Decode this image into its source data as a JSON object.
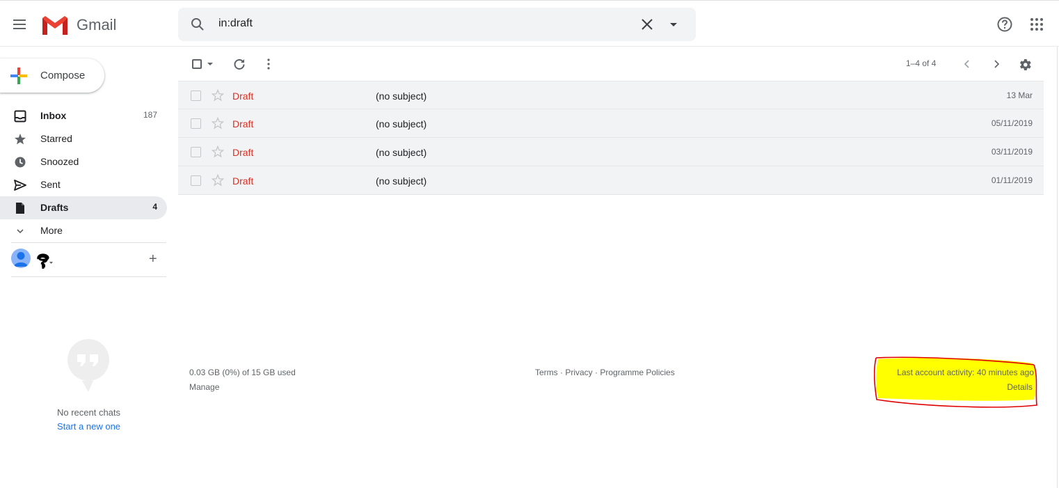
{
  "app": {
    "name": "Gmail"
  },
  "search": {
    "value": "in:draft"
  },
  "compose": {
    "label": "Compose"
  },
  "sidebar": {
    "items": [
      {
        "label": "Inbox",
        "count": "187",
        "icon": "inbox-icon"
      },
      {
        "label": "Starred",
        "count": "",
        "icon": "star-icon"
      },
      {
        "label": "Snoozed",
        "count": "",
        "icon": "clock-icon"
      },
      {
        "label": "Sent",
        "count": "",
        "icon": "send-icon"
      },
      {
        "label": "Drafts",
        "count": "4",
        "icon": "draft-icon"
      },
      {
        "label": "More",
        "count": "",
        "icon": "chevron-down-icon"
      }
    ]
  },
  "hangouts": {
    "empty_text": "No recent chats",
    "start_link": "Start a new one"
  },
  "toolbar": {
    "pager": "1–4 of 4"
  },
  "emails": [
    {
      "sender": "Draft",
      "subject": "(no subject)",
      "date": "13 Mar"
    },
    {
      "sender": "Draft",
      "subject": "(no subject)",
      "date": "05/11/2019"
    },
    {
      "sender": "Draft",
      "subject": "(no subject)",
      "date": "03/11/2019"
    },
    {
      "sender": "Draft",
      "subject": "(no subject)",
      "date": "01/11/2019"
    }
  ],
  "footer": {
    "storage": "0.03 GB (0%) of 15 GB used",
    "manage": "Manage",
    "links": [
      "Terms",
      "Privacy",
      "Programme Policies"
    ],
    "separator": " · ",
    "activity": "Last account activity: 40 minutes ago",
    "details": "Details"
  },
  "colors": {
    "draft_red": "#d93025",
    "highlight_yellow": "#ffff00",
    "annotation_red": "#e00000",
    "link_blue": "#1a73e8"
  }
}
